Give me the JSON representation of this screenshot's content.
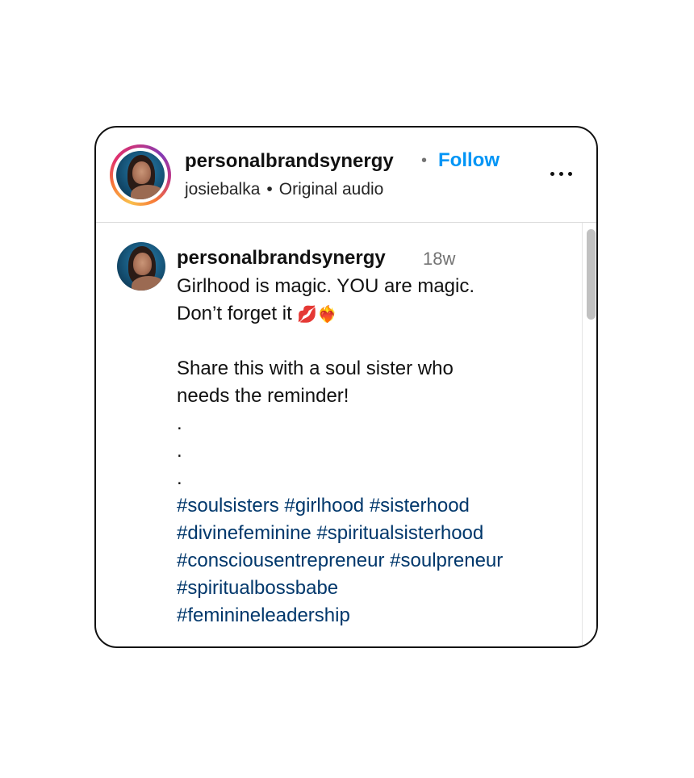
{
  "header": {
    "username": "personalbrandsynergy",
    "separator_dot": "•",
    "follow_label": "Follow",
    "audio_owner": "josiebalka",
    "audio_separator": "•",
    "audio_label": "Original audio",
    "more_icon": "more-horizontal-icon"
  },
  "comment": {
    "username": "personalbrandsynergy",
    "time_ago": "18w",
    "line1": "Girlhood is magic. YOU are magic.",
    "line2": "Don’t forget it",
    "emoji1": "💋",
    "emoji2": "❤‍🔥",
    "line3": "Share this with a soul sister who",
    "line4": "needs the reminder!",
    "dots": [
      ".",
      ".",
      "."
    ],
    "hashtags": [
      "#soulsisters",
      "#girlhood",
      "#sisterhood",
      "#divinefeminine",
      "#spiritualsisterhood",
      "#consciousentrepreneur",
      "#soulpreneur",
      "#spiritualbossbabe",
      "#feminineleadership"
    ]
  },
  "colors": {
    "follow_blue": "#0095f6",
    "hashtag_blue": "#00376b",
    "muted_gray": "#737373"
  }
}
